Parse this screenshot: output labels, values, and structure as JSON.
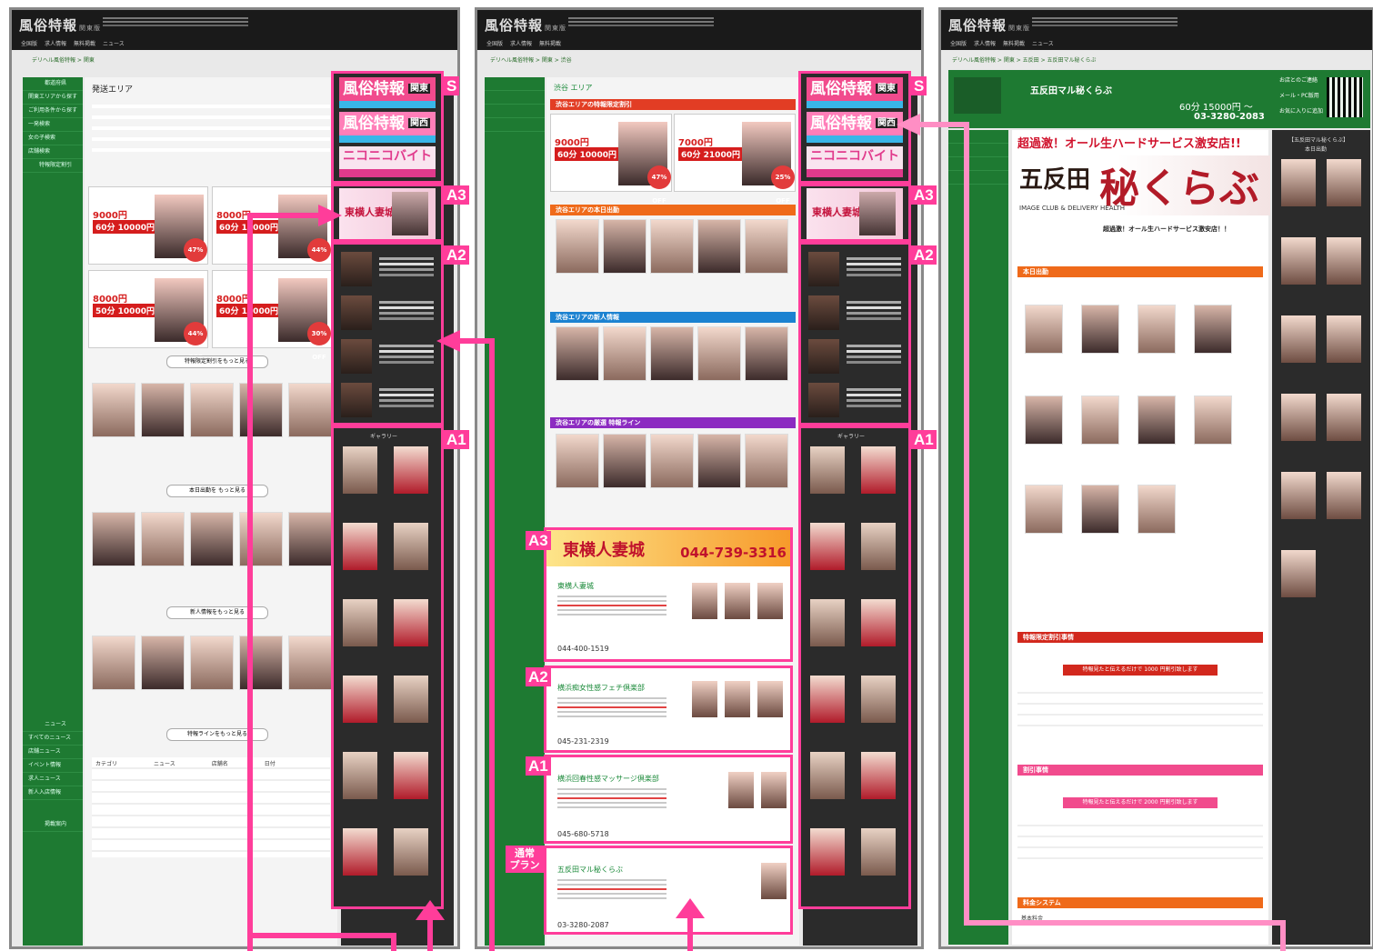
{
  "site": {
    "logo_main": "風俗特報",
    "logo_sub": "関東版",
    "nav": [
      "全国版",
      "求人情報",
      "無料掲載",
      "ニュース"
    ]
  },
  "panel1": {
    "crumb": "デリヘル風俗特報 > 関東",
    "area_title": "発送エリア",
    "sidebar_top": "都道府県",
    "sidebar_items": [
      "関東エリアから探す",
      "ご利用条件から探す",
      "一発検索",
      "女の子検索",
      "店舗検索"
    ],
    "sidebar_news": "ニュース",
    "sidebar_news_items": [
      "すべてのニュース",
      "店舗ニュース",
      "イベント情報",
      "求人ニュース",
      "新人入店情報"
    ],
    "sidebar_bottom": "掲載案内",
    "special": "特報限定割引",
    "cards": [
      {
        "price": "9000円",
        "box": "60分 10000円",
        "off": "47% OFF"
      },
      {
        "price": "8000円",
        "box": "60分 10000円",
        "off": "44% OFF"
      },
      {
        "price": "8000円",
        "box": "50分 10000円",
        "off": "44% OFF"
      },
      {
        "price": "8000円",
        "box": "60分 10000円",
        "off": "30% OFF"
      }
    ],
    "more_buttons": [
      "特報限定割引をもっと見る",
      "本日出勤を もっと見る",
      "新人情報をもっと見る",
      "特報ラインをもっと見る"
    ],
    "news_head": [
      "カテゴリ",
      "ニュース",
      "店舗名",
      "日付"
    ]
  },
  "panel2": {
    "crumb": "デリヘル風俗特報 > 関東 > 渋谷",
    "area": "渋谷 エリア",
    "sections": [
      {
        "label": "渋谷エリアの特報限定割引",
        "color": "#e23d24"
      },
      {
        "label": "渋谷エリアの本日出勤",
        "color": "#ef6a1a"
      },
      {
        "label": "渋谷エリアの新人情報",
        "color": "#1b82d1"
      },
      {
        "label": "渋谷エリアの厳選 特報ライン",
        "color": "#8c2bc1"
      }
    ],
    "prices": [
      {
        "p": "9000円",
        "b": "60分 10000円",
        "off": "47% OFF"
      },
      {
        "p": "7000円",
        "b": "60分 21000円",
        "off": "25% OFF"
      }
    ],
    "shops": [
      {
        "tag": "A3",
        "name": "東横人妻城",
        "tel": "044-400-1519",
        "ad": "東横人妻城",
        "adtel": "044-739-3316"
      },
      {
        "tag": "A2",
        "name": "横浜痴女性感フェチ倶楽部",
        "tel": "045-231-2319"
      },
      {
        "tag": "A1",
        "name": "横浜回春性感マッサージ倶楽部",
        "tel": "045-680-5718"
      },
      {
        "tag": "通常\nプラン",
        "name": "五反田マル秘くらぶ",
        "tel": "03-3280-2087"
      }
    ]
  },
  "panel3": {
    "crumb": "デリヘル風俗特報 > 関東 > 五反田 > 五反田マル秘くらぶ",
    "shop_name": "五反田マル秘くらぶ",
    "price": "60分 15000円 ～",
    "tel": "03-3280-2083",
    "catch": "超過激！オール生ハードサービス激安店!!",
    "logo_en": "五反田",
    "logo_big": "秘くらぶ",
    "sub_en": "IMAGE CLUB & DELIVERY HEALTH",
    "lead": "超過激！オール生ハードサービス激安店！！",
    "section_today": "本日出勤",
    "section_sale": "特報限定割引事情",
    "discount_btn": "特報見たと伝えるだけで 1000 円割引致します",
    "section_new": "割引事情",
    "discount_btn2": "特報見たと伝えるだけで 2000 円割引致します",
    "section_price": "料金システム",
    "price_label": "基本料金",
    "right_title": "【五反田マル秘くらぶ】",
    "right_sub": "本日出勤",
    "right_items": [
      "お店とのご連絡",
      "メール・PC版用",
      "お気に入りに追加"
    ]
  },
  "right_rail": {
    "banner1": "風俗特報",
    "banner1_region": "関東",
    "banner2": "風俗特報",
    "banner2_region": "関西",
    "nico": "ニコニコバイト",
    "a3_title": "東横人妻城",
    "gallery_title": "ギャラリー"
  },
  "tags": {
    "S": "S",
    "A3": "A3",
    "A2": "A2",
    "A1": "A1"
  }
}
